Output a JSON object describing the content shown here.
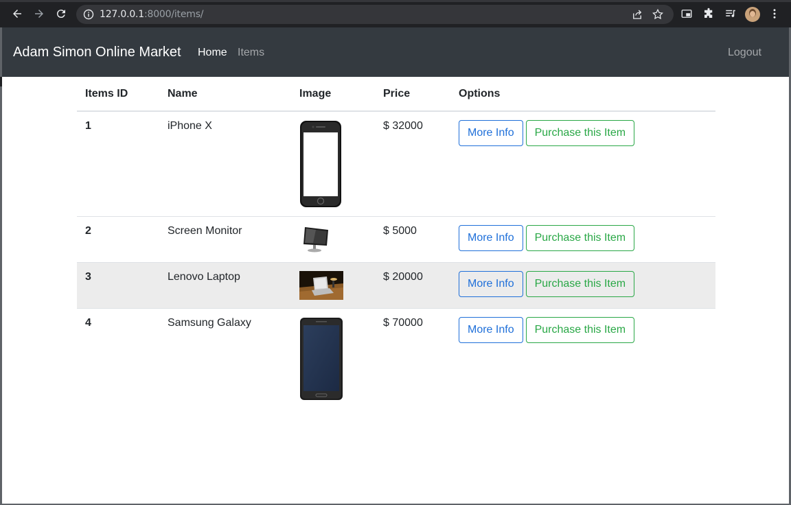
{
  "browser": {
    "url_host": "127.0.0.1",
    "url_rest": ":8000/items/"
  },
  "navbar": {
    "brand": "Adam Simon Online Market",
    "home": "Home",
    "items": "Items",
    "logout": "Logout"
  },
  "table": {
    "headers": [
      "Items ID",
      "Name",
      "Image",
      "Price",
      "Options"
    ],
    "rows": [
      {
        "id": "1",
        "name": "iPhone X",
        "image": "iphone-image",
        "price": "$ 32000"
      },
      {
        "id": "2",
        "name": "Screen Monitor",
        "image": "monitor-image",
        "price": "$ 5000"
      },
      {
        "id": "3",
        "name": "Lenovo Laptop",
        "image": "laptop-image",
        "price": "$ 20000"
      },
      {
        "id": "4",
        "name": "Samsung Galaxy",
        "image": "galaxy-image",
        "price": "$ 70000"
      }
    ],
    "more_info_label": "More Info",
    "purchase_label": "Purchase this Item"
  },
  "colors": {
    "navbar_bg": "#343a40",
    "info_outline": "#1e6fd9",
    "success_outline": "#28a745",
    "hover_row": "#ececec"
  }
}
